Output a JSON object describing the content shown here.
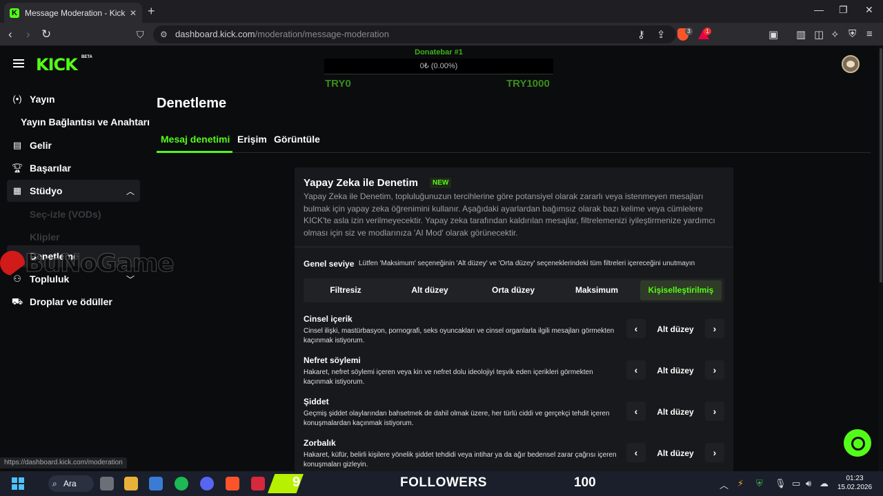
{
  "browser": {
    "tab_title": "Message Moderation - Kick Das",
    "tab_favicon": "K",
    "new_tab": "+",
    "url_host": "dashboard.kick.com",
    "url_path": "/moderation/message-moderation",
    "status_url": "https://dashboard.kick.com/moderation",
    "extension_badge_1": "3",
    "extension_badge_2": "1"
  },
  "header": {
    "logo_text": "KICK",
    "logo_beta": "BETA",
    "donate_title": "Donatebar #1",
    "donate_progress": "0₺ (0.00%)",
    "donate_progress_fraction": 0.0,
    "donate_min": "TRY0",
    "donate_max": "TRY1000"
  },
  "sidebar": {
    "items": [
      {
        "label": "Yayın",
        "icon": "broadcast-icon"
      },
      {
        "label": "Yayın Bağlantısı ve Anahtarı",
        "icon": ""
      },
      {
        "label": "Gelir",
        "icon": "revenue-chart-icon"
      },
      {
        "label": "Başarılar",
        "icon": "trophy-icon"
      },
      {
        "label": "Stüdyo",
        "icon": "studio-icon",
        "expanded": true
      },
      {
        "label": "Seç-izle (VODs)",
        "sub": true
      },
      {
        "label": "Klipler",
        "sub": true
      },
      {
        "label": "Denetleme",
        "icon": "moderation-icon",
        "active": true
      },
      {
        "label": "Topluluk",
        "icon": "community-icon",
        "expanded": false
      },
      {
        "label": "Droplar ve ödüller",
        "icon": "drops-icon"
      }
    ]
  },
  "main": {
    "title": "Denetleme",
    "tabs": [
      {
        "label": "Mesaj denetimi",
        "active": true
      },
      {
        "label": "Erişim",
        "active": false
      },
      {
        "label": "Görüntüle",
        "active": false
      }
    ],
    "card": {
      "title": "Yapay Zeka ile Denetim",
      "badge": "NEW",
      "description": "Yapay Zeka ile Denetim, topluluğunuzun tercihlerine göre potansiyel olarak zararlı veya istenmeyen mesajları bulmak için yapay zeka öğrenimini kullanır. Aşağıdaki ayarlardan bağımsız olarak bazı kelime veya cümlelere KICK'te asla izin verilmeyecektir. Yapay zeka tarafından kaldırılan mesajlar, filtrelemenizi iyileştirmenize yardımcı olması için siz ve modlarınıza 'AI Mod' olarak görünecektir.",
      "level_label": "Genel seviye",
      "level_note": "Lütfen 'Maksimum' seçeneğinin 'Alt düzey' ve 'Orta düzey' seçeneklerindeki tüm filtreleri içereceğini unutmayın",
      "levels": [
        "Filtresiz",
        "Alt düzey",
        "Orta düzey",
        "Maksimum",
        "Kişiselleştirilmiş"
      ],
      "selected_level": "Kişiselleştirilmiş",
      "categories": [
        {
          "title": "Cinsel içerik",
          "desc": "Cinsel ilişki, mastürbasyon, pornografi, seks oyuncakları ve cinsel organlarla ilgili mesajları görmekten kaçınmak istiyorum.",
          "value": "Alt düzey"
        },
        {
          "title": "Nefret söylemi",
          "desc": "Hakaret, nefret söylemi içeren veya kin ve nefret dolu ideolojiyi teşvik eden içerikleri görmekten kaçınmak istiyorum.",
          "value": "Alt düzey"
        },
        {
          "title": "Şiddet",
          "desc": "Geçmiş şiddet olaylarından bahsetmek de dahil olmak üzere, her türlü ciddi ve gerçekçi tehdit içeren konuşmalardan kaçınmak istiyorum.",
          "value": "Alt düzey"
        },
        {
          "title": "Zorbalık",
          "desc": "Hakaret, küfür, belirli kişilere yönelik şiddet tehdidi veya intihar ya da ağır bedensel zarar çağrısı içeren konuşmaları gizleyin.",
          "value": "Alt düzey"
        }
      ]
    }
  },
  "watermark": {
    "text": "BuNoGame"
  },
  "taskbar": {
    "search_label": "Ara",
    "banner_number": "9",
    "banner_label": "FOLLOWERS",
    "banner_count": "100",
    "time": "01:23",
    "date": "15.02.2026"
  },
  "colors": {
    "accent": "#53fc18",
    "background": "#0b0c0e",
    "card": "#18191c"
  }
}
